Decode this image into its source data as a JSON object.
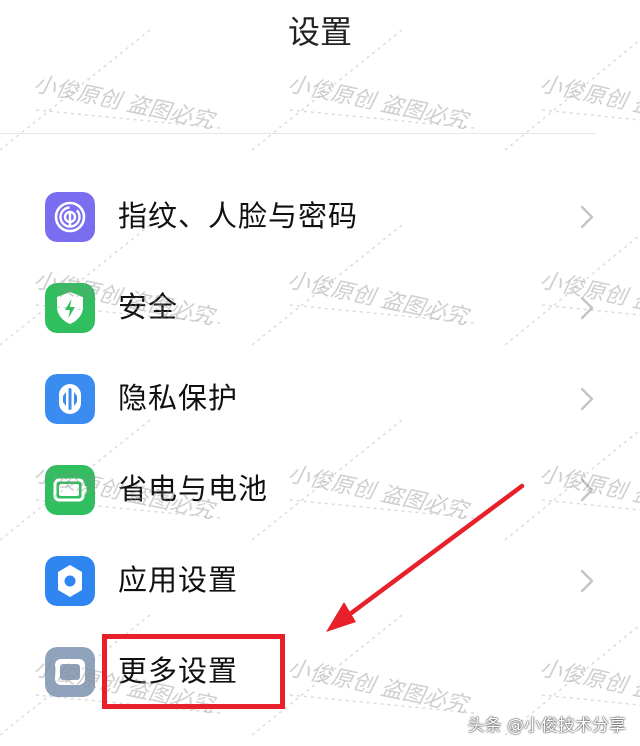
{
  "header": {
    "title": "设置"
  },
  "menu": {
    "items": [
      {
        "label": "指纹、人脸与密码",
        "icon": "fingerprint-icon",
        "color": "#7b6df0"
      },
      {
        "label": "安全",
        "icon": "shield-icon",
        "color": "#2fbf5e"
      },
      {
        "label": "隐私保护",
        "icon": "privacy-icon",
        "color": "#3b8cf0"
      },
      {
        "label": "省电与电池",
        "icon": "battery-icon",
        "color": "#2fbf5e"
      },
      {
        "label": "应用设置",
        "icon": "gear-icon",
        "color": "#2f86f0"
      },
      {
        "label": "更多设置",
        "icon": "more-settings-icon",
        "color": "#8fa3bd"
      }
    ]
  },
  "watermark": {
    "text": "小俊原创 盗图必究"
  },
  "credit": {
    "text": "头条 @小俊技术分享"
  },
  "colors": {
    "highlight": "#e8202a",
    "chevron": "#c4c4c4"
  }
}
